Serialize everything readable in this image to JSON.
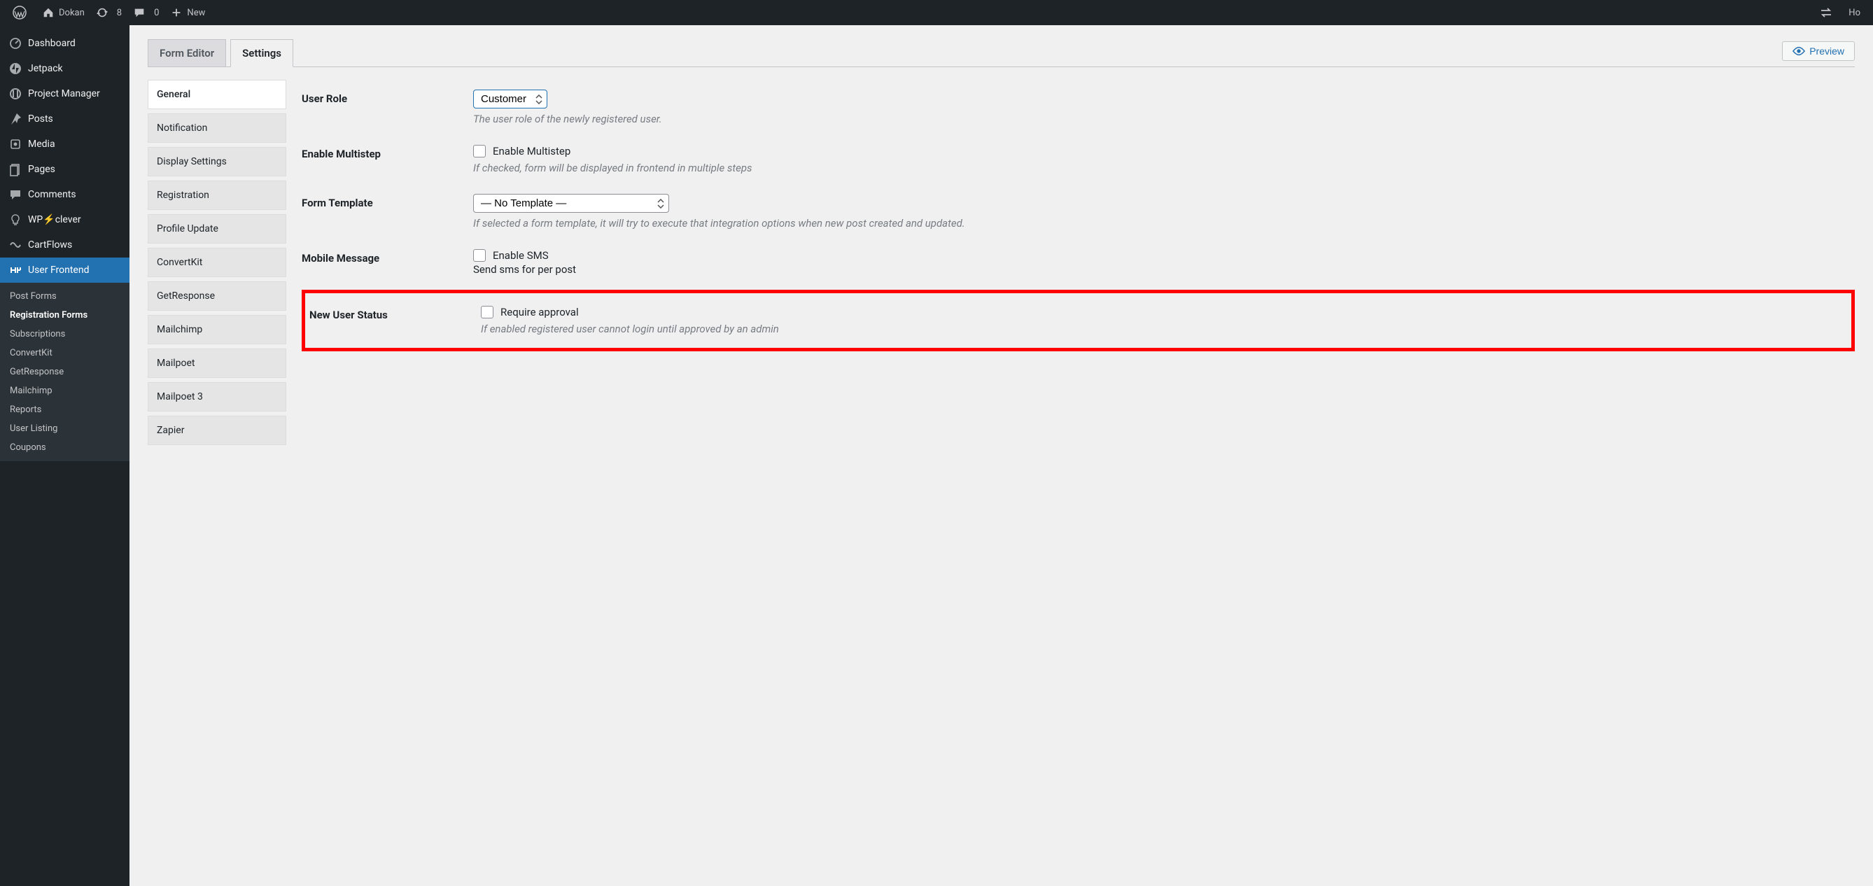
{
  "adminbar": {
    "site_name": "Dokan",
    "updates": "8",
    "comments": "0",
    "new_label": "New",
    "howdy_prefix": "Ho"
  },
  "sidebar": {
    "items": [
      {
        "label": "Dashboard",
        "icon": "dashboard"
      },
      {
        "label": "Jetpack",
        "icon": "jetpack"
      },
      {
        "label": "Project Manager",
        "icon": "project"
      },
      {
        "label": "Posts",
        "icon": "posts"
      },
      {
        "label": "Media",
        "icon": "media"
      },
      {
        "label": "Pages",
        "icon": "pages"
      },
      {
        "label": "Comments",
        "icon": "comments"
      },
      {
        "label": "WP⚡clever",
        "icon": "wpclever"
      },
      {
        "label": "CartFlows",
        "icon": "cartflows"
      },
      {
        "label": "User Frontend",
        "icon": "userfrontend",
        "current": true
      }
    ],
    "submenu": [
      "Post Forms",
      "Registration Forms",
      "Subscriptions",
      "ConvertKit",
      "GetResponse",
      "Mailchimp",
      "Reports",
      "User Listing",
      "Coupons"
    ],
    "submenu_current": "Registration Forms"
  },
  "tabs": {
    "items": [
      "Form Editor",
      "Settings"
    ],
    "active": "Settings"
  },
  "preview_label": "Preview",
  "settings_nav": {
    "items": [
      "General",
      "Notification",
      "Display Settings",
      "Registration",
      "Profile Update",
      "ConvertKit",
      "GetResponse",
      "Mailchimp",
      "Mailpoet",
      "Mailpoet 3",
      "Zapier"
    ],
    "active": "General"
  },
  "form": {
    "user_role": {
      "label": "User Role",
      "value": "Customer",
      "desc": "The user role of the newly registered user."
    },
    "enable_multistep": {
      "label": "Enable Multistep",
      "checkbox_label": "Enable Multistep",
      "desc": "If checked, form will be displayed in frontend in multiple steps"
    },
    "form_template": {
      "label": "Form Template",
      "value": "— No Template —",
      "desc": "If selected a form template, it will try to execute that integration options when new post created and updated."
    },
    "mobile_message": {
      "label": "Mobile Message",
      "checkbox_label": "Enable SMS",
      "sub": "Send sms for per post"
    },
    "new_user_status": {
      "label": "New User Status",
      "checkbox_label": "Require approval",
      "desc": "If enabled registered user cannot login until approved by an admin"
    }
  }
}
